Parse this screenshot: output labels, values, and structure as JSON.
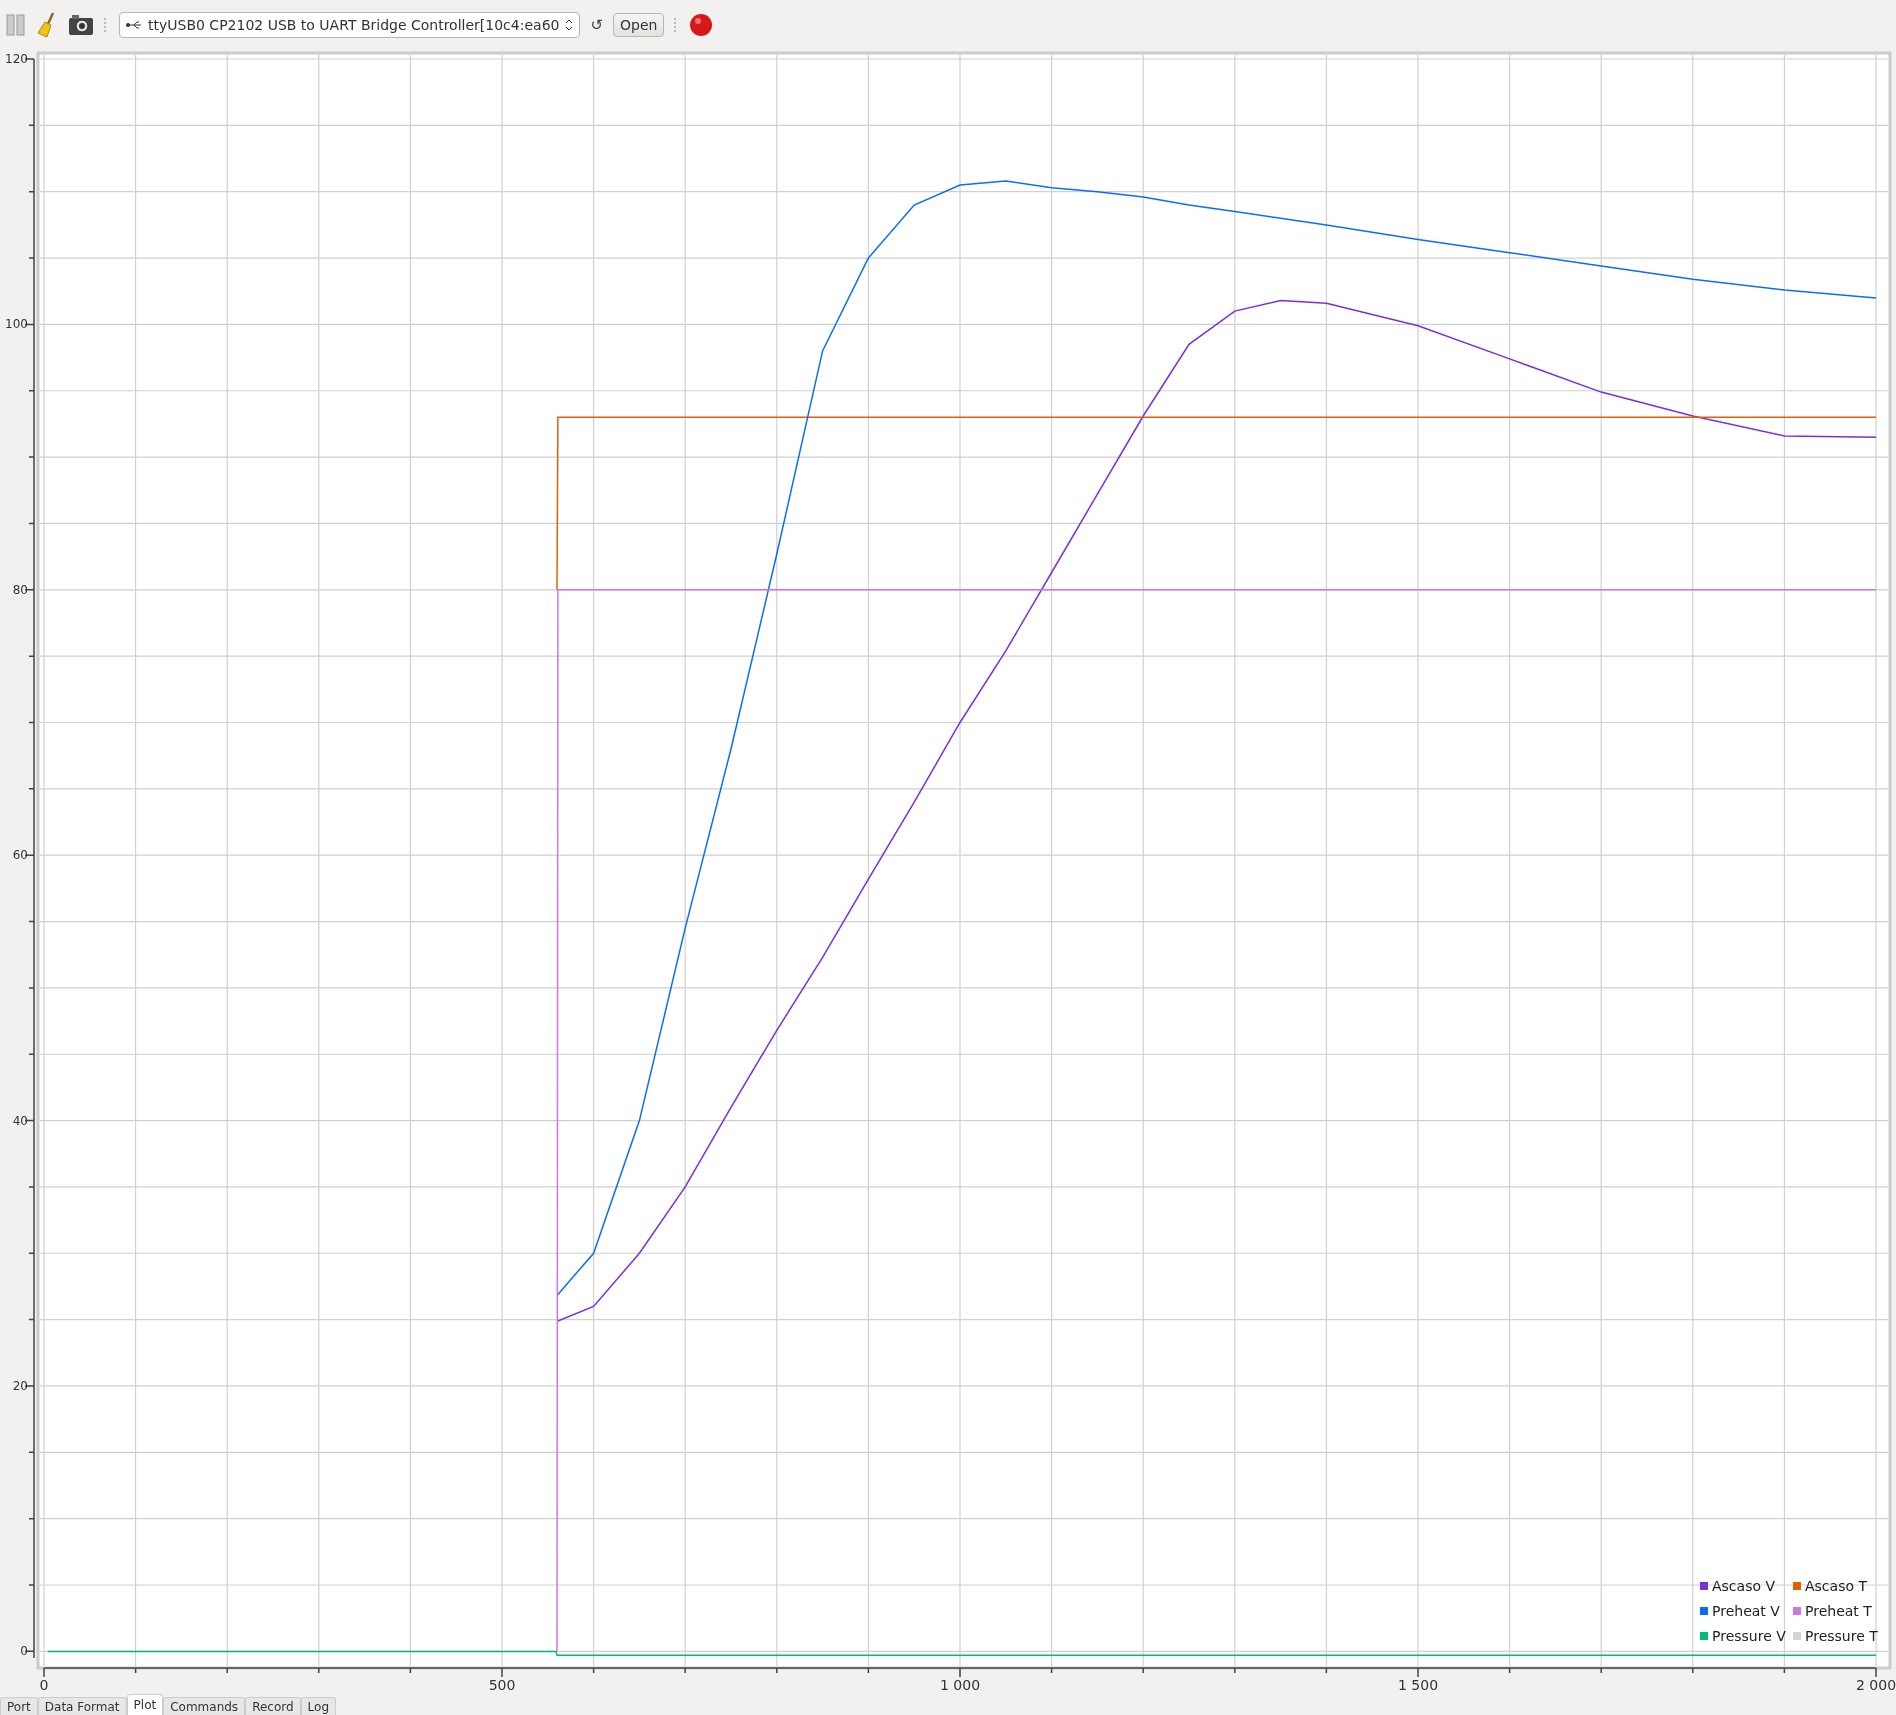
{
  "toolbar": {
    "port_select": {
      "value": "ttyUSB0 CP2102 USB to UART Bridge Controller[10c4:ea60"
    },
    "refresh_button": "↺",
    "open_button": "Open"
  },
  "plot": {
    "chart_data": {
      "type": "line",
      "x": [
        4,
        559,
        560,
        561,
        600,
        650,
        700,
        750,
        800,
        850,
        900,
        950,
        1000,
        1050,
        1100,
        1150,
        1200,
        1250,
        1300,
        1350,
        1400,
        1500,
        1600,
        1700,
        1800,
        1900,
        2000
      ],
      "series": [
        {
          "name": "Ascaso V",
          "color": "#7b2fd8",
          "values": [
            null,
            null,
            24.9,
            24.9,
            26,
            30,
            35,
            41,
            46.8,
            52.3,
            58.2,
            64,
            70,
            75.4,
            81.3,
            87.2,
            93.1,
            98.5,
            101,
            101.8,
            101.6,
            99.9,
            97.4,
            94.9,
            93.1,
            91.6,
            91.5
          ]
        },
        {
          "name": "Ascaso T",
          "color": "#e0600a",
          "values": [
            null,
            null,
            80,
            93,
            93,
            93,
            93,
            93,
            93,
            93,
            93,
            93,
            93,
            93,
            93,
            93,
            93,
            93,
            93,
            93,
            93,
            93,
            93,
            93,
            93,
            93,
            93
          ]
        },
        {
          "name": "Preheat V",
          "color": "#0a6ef5",
          "values": [
            null,
            null,
            26.9,
            26.9,
            30,
            40,
            54.5,
            68,
            82.7,
            98,
            105,
            109,
            110.5,
            110.8,
            110.3,
            110,
            109.6,
            109,
            108.5,
            108,
            107.5,
            106.4,
            105.4,
            104.4,
            103.4,
            102.6,
            102
          ]
        },
        {
          "name": "Preheat T",
          "color": "#cc77ee",
          "values": [
            null,
            null,
            0,
            80,
            80,
            80,
            80,
            80,
            80,
            80,
            80,
            80,
            80,
            80,
            80,
            80,
            80,
            80,
            80,
            80,
            80,
            80,
            80,
            80,
            80,
            80,
            80
          ]
        },
        {
          "name": "Pressure V",
          "color": "#00bb77",
          "values": [
            0,
            0,
            -0.3,
            -0.3,
            -0.3,
            -0.3,
            -0.3,
            -0.3,
            -0.3,
            -0.3,
            -0.3,
            -0.3,
            -0.3,
            -0.3,
            -0.3,
            -0.3,
            -0.3,
            -0.3,
            -0.3,
            -0.3,
            -0.3,
            -0.3,
            -0.3,
            -0.3,
            -0.3,
            -0.3,
            -0.3
          ]
        },
        {
          "name": "Pressure T",
          "color": "#d3d3d3",
          "values": [
            null,
            null,
            null,
            null,
            null,
            null,
            null,
            null,
            null,
            null,
            null,
            null,
            null,
            null,
            null,
            null,
            null,
            null,
            null,
            null,
            null,
            null,
            null,
            null,
            null,
            null,
            null
          ]
        }
      ],
      "xlim": [
        0,
        2000
      ],
      "ylim": [
        -0.5,
        120
      ],
      "xticks": [
        {
          "value": 0,
          "label": "0"
        },
        {
          "value": 500,
          "label": "500"
        },
        {
          "value": 1000,
          "label": "1 000"
        },
        {
          "value": 1500,
          "label": "1 500"
        },
        {
          "value": 2000,
          "label": "2 000"
        }
      ],
      "yticks": [
        0,
        20,
        40,
        60,
        80,
        100,
        120
      ],
      "grid": true,
      "legend": true
    }
  },
  "tabs": [
    {
      "label": "Port",
      "selected": false
    },
    {
      "label": "Data Format",
      "selected": false
    },
    {
      "label": "Plot",
      "selected": true
    },
    {
      "label": "Commands",
      "selected": false
    },
    {
      "label": "Record",
      "selected": false
    },
    {
      "label": "Log",
      "selected": false
    }
  ]
}
